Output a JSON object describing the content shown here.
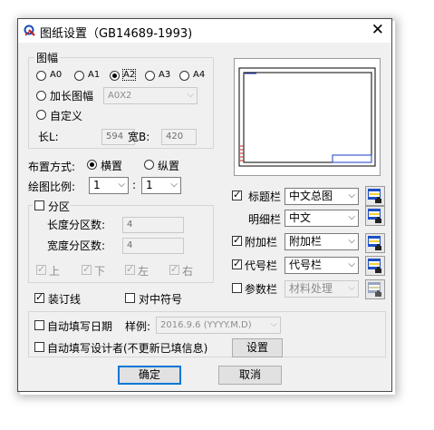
{
  "window": {
    "title": "图纸设置（GB14689-1993)"
  },
  "sheet_size": {
    "group_label": "图幅",
    "options": [
      "A0",
      "A1",
      "A2",
      "A3",
      "A4"
    ],
    "selected": "A2",
    "extended_label": "加长图幅",
    "extended_value": "A0X2",
    "custom_label": "自定义",
    "length_label": "长L:",
    "length_value": "594",
    "width_label": "宽B:",
    "width_value": "420"
  },
  "layout": {
    "orientation_label": "布置方式:",
    "landscape": "横置",
    "portrait": "纵置",
    "selected": "横置",
    "scale_label": "绘图比例:",
    "scale_left": "1",
    "scale_sep": ":",
    "scale_right": "1"
  },
  "zones": {
    "label": "分区",
    "checked": false,
    "length_label": "长度分区数:",
    "length_value": "4",
    "width_label": "宽度分区数:",
    "width_value": "4",
    "sides": [
      {
        "label": "上",
        "checked": true
      },
      {
        "label": "下",
        "checked": true
      },
      {
        "label": "左",
        "checked": true
      },
      {
        "label": "右",
        "checked": true
      }
    ]
  },
  "binding_line": {
    "label": "装订线",
    "checked": true
  },
  "center_mark": {
    "label": "对中符号",
    "checked": false
  },
  "blocks": {
    "title_block": {
      "label": "标题栏",
      "checked": true,
      "value": "中文总图"
    },
    "detail_block": {
      "label": "明细栏",
      "value": "中文"
    },
    "extra_block": {
      "label": "附加栏",
      "checked": true,
      "value": "附加栏"
    },
    "code_block": {
      "label": "代号栏",
      "checked": true,
      "value": "代号栏"
    },
    "param_block": {
      "label": "参数栏",
      "checked": false,
      "value": "材料处理"
    }
  },
  "auto_date": {
    "label": "自动填写日期",
    "checked": false,
    "example_label": "样例:",
    "example_value": "2016.9.6 (YYYY.M.D)"
  },
  "auto_designer": {
    "label": "自动填写设计者(不更新已填信息)",
    "checked": false,
    "settings_button": "设置"
  },
  "footer": {
    "ok": "确定",
    "cancel": "取消"
  }
}
